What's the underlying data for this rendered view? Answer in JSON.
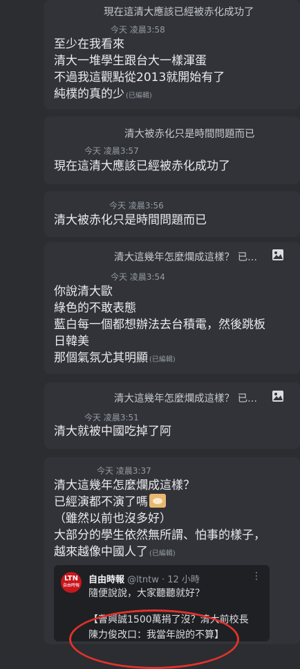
{
  "messages": [
    {
      "reply_preview": "現在這清大應該已經被赤化成功了",
      "timestamp": "今天 凌晨3:58",
      "lines": [
        "至少在我看來",
        "清大一堆學生跟台大一樣渾蛋",
        "不過我這觀點從2013就開始有了",
        "純樸的真的少"
      ],
      "edited": "(已編輯)"
    },
    {
      "reply_preview": "清大被赤化只是時間問題而已",
      "timestamp": "今天 凌晨3:57",
      "lines": [
        "現在這清大應該已經被赤化成功了"
      ]
    },
    {
      "timestamp": "今天 凌晨3:56",
      "lines": [
        "清大被赤化只是時間問題而已"
      ]
    },
    {
      "reply_preview": "清大這幾年怎麼爛成這樣？ 已...",
      "timestamp": "今天 凌晨3:54",
      "lines": [
        "你說清大歐",
        "綠色的不敢表態",
        "藍白每一個都想辦法去台積電，然後跳板",
        "日韓美",
        "那個氣氛尤其明顯"
      ],
      "edited": "(已編輯)"
    },
    {
      "reply_preview": "清大這幾年怎麼爛成這樣？ 已...",
      "timestamp": "今天 凌晨3:51",
      "lines": [
        "清大就被中國吃掉了阿"
      ]
    },
    {
      "timestamp": "今天 凌晨3:37",
      "lines": [
        "清大這幾年怎麼爛成這樣？",
        "已經演都不演了嗎",
        "（雖然以前也沒多好）",
        "大部分的學生依然無所謂、怕事的樣子，",
        "越來越像中國人了"
      ],
      "edited": "(已編輯)"
    }
  ],
  "embed": {
    "logo_text": "LTN",
    "logo_sub": "自由時報",
    "author_name": "自由時報",
    "author_handle": "@ltntw · 12 小時",
    "more": "⋮",
    "text": "隨便說說，大家聽聽就好？",
    "body_lines": [
      "【曹興誠1500萬捐了沒？清大前校長",
      "陳力俊改口：我當年說的不算】"
    ]
  },
  "colors": {
    "background": "#2b2d31",
    "card": "#313338",
    "annotation": "#e0322b",
    "logo": "#c8161d"
  },
  "icons": {
    "image_attachment": "image-icon"
  }
}
